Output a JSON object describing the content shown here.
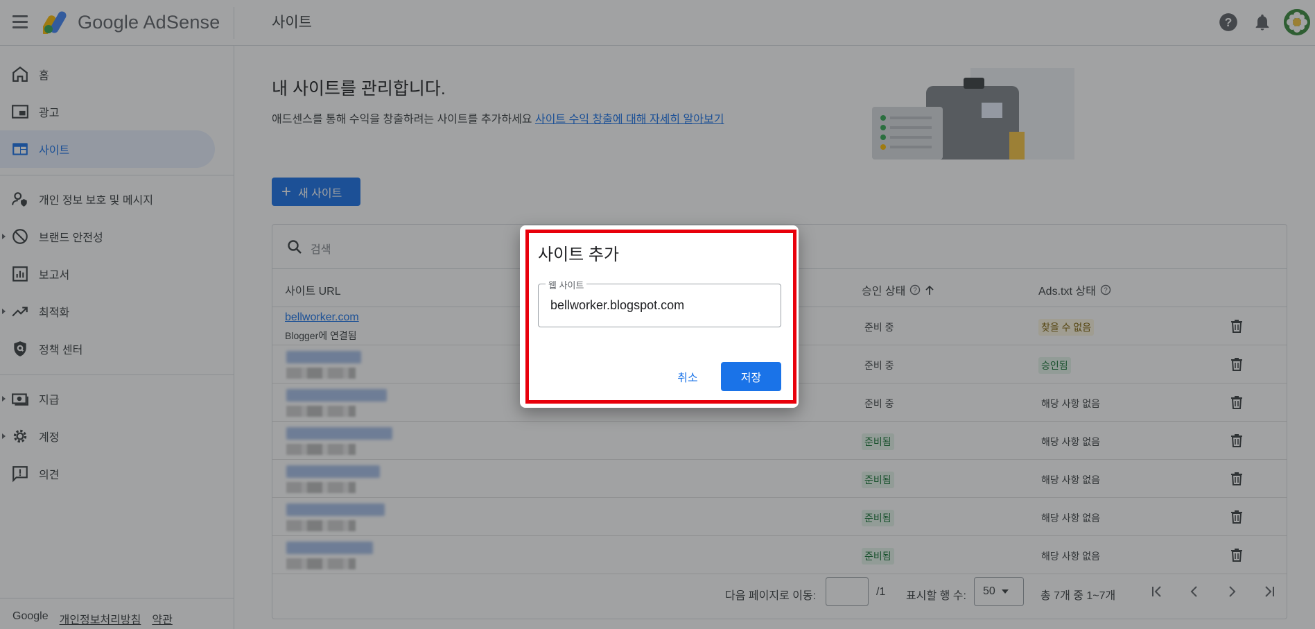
{
  "app": {
    "logo_text": "Google AdSense",
    "page_title": "사이트"
  },
  "sidebar": {
    "items": [
      {
        "label": "홈"
      },
      {
        "label": "광고"
      },
      {
        "label": "사이트"
      },
      {
        "label": "개인 정보 보호 및 메시지"
      },
      {
        "label": "브랜드 안전성"
      },
      {
        "label": "보고서"
      },
      {
        "label": "최적화"
      },
      {
        "label": "정책 센터"
      },
      {
        "label": "지급"
      },
      {
        "label": "계정"
      },
      {
        "label": "의견"
      }
    ],
    "footer": {
      "google": "Google",
      "privacy": "개인정보처리방침",
      "terms": "약관"
    }
  },
  "main": {
    "heading": "내 사이트를 관리합니다.",
    "subtitle": "애드센스를 통해 수익을 창출하려는 사이트를 추가하세요",
    "learn_more": "사이트 수익 창출에 대해 자세히 알아보기",
    "new_site_label": "새 사이트",
    "search_placeholder": "검색"
  },
  "table": {
    "columns": {
      "site_url": "사이트 URL",
      "approval": "승인 상태",
      "ads_txt": "Ads.txt 상태"
    },
    "rows": [
      {
        "url": "bellworker.com",
        "sub": "Blogger에 연결됨",
        "approval": "준비 중",
        "ads_txt": "찾을 수 없음"
      },
      {
        "approval": "준비 중",
        "ads_txt": "승인됨"
      },
      {
        "approval": "준비 중",
        "ads_txt": "해당 사항 없음"
      },
      {
        "approval": "준비됨",
        "ads_txt": "해당 사항 없음"
      },
      {
        "approval": "준비됨",
        "ads_txt": "해당 사항 없음"
      },
      {
        "approval": "준비됨",
        "ads_txt": "해당 사항 없음"
      },
      {
        "approval": "준비됨",
        "ads_txt": "해당 사항 없음"
      }
    ],
    "pager": {
      "goto_label": "다음 페이지로 이동:",
      "total_pages": "/1",
      "rows_label": "표시할 행 수:",
      "rows_value": "50",
      "range": "총 7개 중 1~7개"
    }
  },
  "dialog": {
    "title": "사이트 추가",
    "field_label": "웹 사이트",
    "field_value": "bellworker.blogspot.com",
    "cancel": "취소",
    "save": "저장"
  },
  "colors": {
    "accent": "#1a73e8",
    "highlight": "#e8000b",
    "ready_chip": "#e6f4ea",
    "notfound_chip": "#fef7e0"
  }
}
